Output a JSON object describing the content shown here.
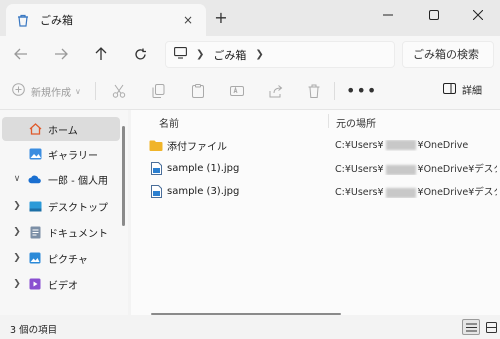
{
  "window": {
    "tab_title": "ごみ箱",
    "tab_close": "×",
    "new_tab": "+"
  },
  "nav": {
    "address_segment": "ごみ箱",
    "search_placeholder": "ごみ箱の検索"
  },
  "commands": {
    "new_label": "新規作成",
    "more": "•••",
    "details_label": "詳細"
  },
  "sidebar": {
    "items": [
      {
        "label": "ホーム",
        "icon": "home-icon"
      },
      {
        "label": "ギャラリー",
        "icon": "gallery-icon"
      },
      {
        "label": "一郎 - 個人用",
        "icon": "onedrive-cloud-icon"
      },
      {
        "label": "デスクトップ",
        "icon": "desktop-icon"
      },
      {
        "label": "ドキュメント",
        "icon": "documents-icon"
      },
      {
        "label": "ピクチャ",
        "icon": "pictures-icon"
      },
      {
        "label": "ビデオ",
        "icon": "videos-icon"
      }
    ]
  },
  "list": {
    "columns": [
      "名前",
      "元の場所"
    ],
    "rows": [
      {
        "name": "添付ファイル",
        "loc_prefix": "C:¥Users¥",
        "loc_suffix": "¥OneDrive",
        "icon": "folder-icon"
      },
      {
        "name": "sample (1).jpg",
        "loc_prefix": "C:¥Users¥",
        "loc_suffix": "¥OneDrive¥デスクトップ",
        "icon": "image-file-icon"
      },
      {
        "name": "sample (3).jpg",
        "loc_prefix": "C:¥Users¥",
        "loc_suffix": "¥OneDrive¥デスクトップ",
        "icon": "image-file-icon"
      }
    ]
  },
  "status": {
    "item_count": "3 個の項目"
  },
  "colors": {
    "folder": "#f0b429",
    "onedrive": "#1a6fd0",
    "selected": "#dcdcdc"
  }
}
